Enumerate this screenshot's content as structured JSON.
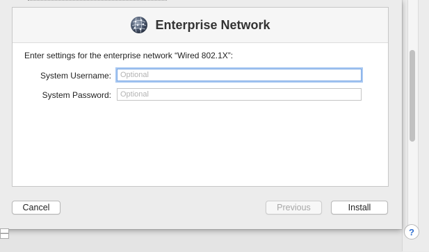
{
  "window": {
    "title": "Enterprise Network",
    "icon": "globe-icon"
  },
  "form": {
    "prompt": "Enter settings for the enterprise network “Wired 802.1X”:",
    "username": {
      "label": "System Username:",
      "value": "",
      "placeholder": "Optional"
    },
    "password": {
      "label": "System Password:",
      "value": "",
      "placeholder": "Optional"
    }
  },
  "buttons": {
    "cancel": "Cancel",
    "previous": "Previous",
    "install": "Install"
  },
  "background": {
    "help": "?",
    "minus": "—"
  },
  "colors": {
    "focus_ring": "#a8c8f2",
    "help_glyph": "#2f6fd0"
  }
}
